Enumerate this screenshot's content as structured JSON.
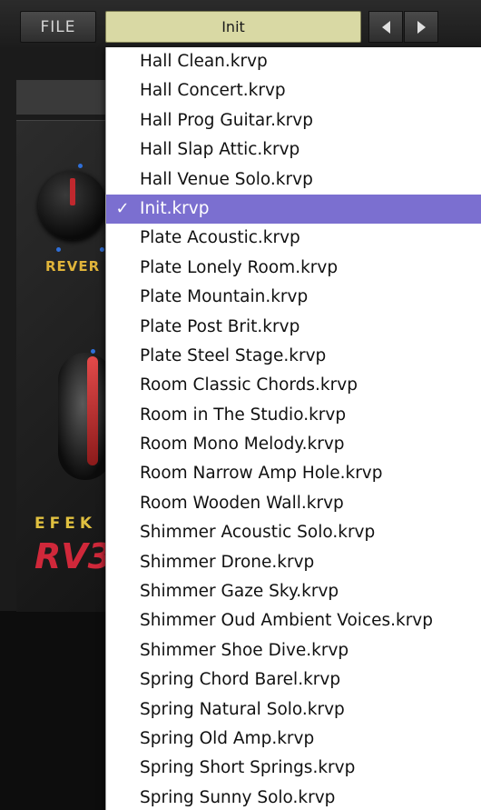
{
  "toolbar": {
    "file_label": "FILE",
    "preset_name": "Init",
    "prev_icon": "triangle-left",
    "next_icon": "triangle-right"
  },
  "plugin": {
    "knob_label": "REVER",
    "brand": "EFEK",
    "model": "RV3",
    "accent_colors": {
      "knob_indicator": "#c0282e",
      "label_yellow": "#e0b43a",
      "dot_blue": "#2f6fd9"
    }
  },
  "menu": {
    "selected_index": 5,
    "check_glyph": "✓",
    "highlight_color": "#7b6fd0",
    "items": [
      "Hall Clean.krvp",
      "Hall Concert.krvp",
      "Hall Prog Guitar.krvp",
      "Hall Slap Attic.krvp",
      "Hall Venue Solo.krvp",
      "Init.krvp",
      "Plate Acoustic.krvp",
      "Plate Lonely Room.krvp",
      "Plate Mountain.krvp",
      "Plate Post Brit.krvp",
      "Plate Steel Stage.krvp",
      "Room Classic Chords.krvp",
      "Room in The Studio.krvp",
      "Room Mono Melody.krvp",
      "Room Narrow Amp Hole.krvp",
      "Room Wooden Wall.krvp",
      "Shimmer Acoustic Solo.krvp",
      "Shimmer Drone.krvp",
      "Shimmer Gaze Sky.krvp",
      "Shimmer Oud Ambient Voices.krvp",
      "Shimmer Shoe Dive.krvp",
      "Spring Chord Barel.krvp",
      "Spring Natural Solo.krvp",
      "Spring Old Amp.krvp",
      "Spring Short Springs.krvp",
      "Spring Sunny Solo.krvp"
    ]
  }
}
